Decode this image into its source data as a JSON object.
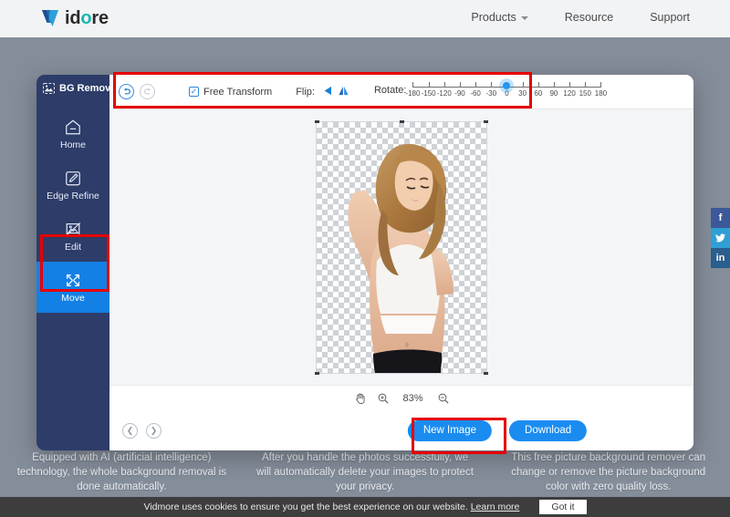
{
  "header": {
    "logo_text_a": "id",
    "logo_text_o": "o",
    "logo_text_b": "re",
    "nav": [
      {
        "label": "Products",
        "has_caret": true
      },
      {
        "label": "Resource",
        "has_caret": false
      },
      {
        "label": "Support",
        "has_caret": false
      }
    ]
  },
  "social": [
    {
      "name": "facebook-icon",
      "glyph": "f"
    },
    {
      "name": "twitter-icon",
      "glyph": "ᵛ"
    },
    {
      "name": "linkedin-icon",
      "glyph": "in"
    }
  ],
  "app": {
    "sidebar": {
      "title": "BG Remover",
      "items": [
        {
          "label": "Home",
          "icon": "home-icon",
          "active": false
        },
        {
          "label": "Edge Refine",
          "icon": "edge-refine-icon",
          "active": false
        },
        {
          "label": "Edit",
          "icon": "edit-image-icon",
          "active": false
        },
        {
          "label": "Move",
          "icon": "move-icon",
          "active": true
        }
      ]
    },
    "toolbar": {
      "undo_label": "undo-icon",
      "redo_label": "redo-icon",
      "free_transform_label": "Free Transform",
      "free_transform_checked": true,
      "flip_label": "Flip:",
      "flip_horizontal_icon": "flip-horizontal-icon",
      "flip_vertical_icon": "flip-vertical-icon",
      "rotate_label": "Rotate:",
      "rotate_value": 0,
      "rotate_min": -180,
      "rotate_max": 180,
      "rotate_ticks": [
        -180,
        -150,
        -120,
        -90,
        -60,
        -30,
        0,
        30,
        60,
        90,
        120,
        150,
        180
      ]
    },
    "zoombar": {
      "hand_icon": "hand-tool-icon",
      "zoom_in_icon": "zoom-in-icon",
      "zoom_out_icon": "zoom-out-icon",
      "zoom_value": "83%"
    },
    "actionbar": {
      "prev_icon": "prev-arrow-icon",
      "next_icon": "next-arrow-icon",
      "new_image_label": "New Image",
      "download_label": "Download"
    }
  },
  "features": [
    "Equipped with AI (artificial intelligence) technology, the whole background removal is done automatically.",
    "After you handle the photos successfully, we will automatically delete your images to protect your privacy.",
    "This free picture background remover can change or remove the picture background color with zero quality loss."
  ],
  "cookie": {
    "message": "Vidmore uses cookies to ensure you get the best experience on our website.",
    "link_label": "Learn more",
    "button_label": "Got it"
  },
  "colors": {
    "brand_blue": "#1a8cf0",
    "sidebar_navy": "#2d3c68",
    "annotation_red": "#e60000",
    "logo_teal": "#19b6b0"
  }
}
